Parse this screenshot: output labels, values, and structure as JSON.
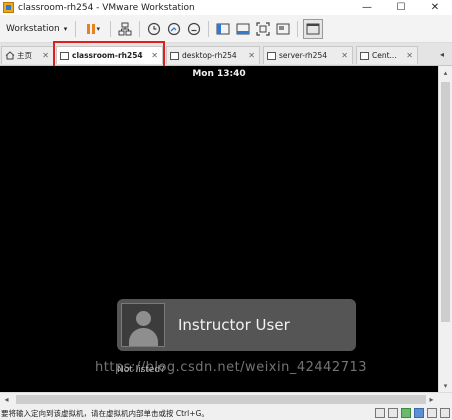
{
  "window": {
    "title": "classroom-rh254 - VMware Workstation",
    "controls": {
      "minimize": "—",
      "maximize": "☐",
      "close": "✕"
    }
  },
  "toolbar": {
    "workstation_menu": "Workstation",
    "caret": "▾",
    "pause_caret": "▾"
  },
  "tabs": [
    {
      "label": "主页",
      "icon": "home-icon",
      "close": "✕",
      "active": false
    },
    {
      "label": "classroom-rh254",
      "icon": "vm-icon",
      "close": "✕",
      "active": true
    },
    {
      "label": "desktop-rh254",
      "icon": "vm-icon",
      "close": "✕",
      "active": false
    },
    {
      "label": "server-rh254",
      "icon": "vm-icon",
      "close": "✕",
      "active": false
    },
    {
      "label": "Cent...",
      "icon": "vm-icon",
      "close": "✕",
      "active": false
    }
  ],
  "tab_scroll": "◂",
  "vm": {
    "clock": "Mon 13:40",
    "user_name": "Instructor User",
    "not_listed": "Not listed?"
  },
  "scroll": {
    "up": "▴",
    "down": "▾",
    "left": "◂",
    "right": "▸"
  },
  "statusbar": {
    "text": "要将输入定向到该虚拟机，请在虚拟机内部单击或按 Ctrl+G。"
  },
  "watermark": "https://blog.csdn.net/weixin_42442713",
  "colors": {
    "accent_pause": "#e8821e",
    "tab_highlight": "#e02020",
    "vm_background": "#000000",
    "user_card": "#555555"
  }
}
